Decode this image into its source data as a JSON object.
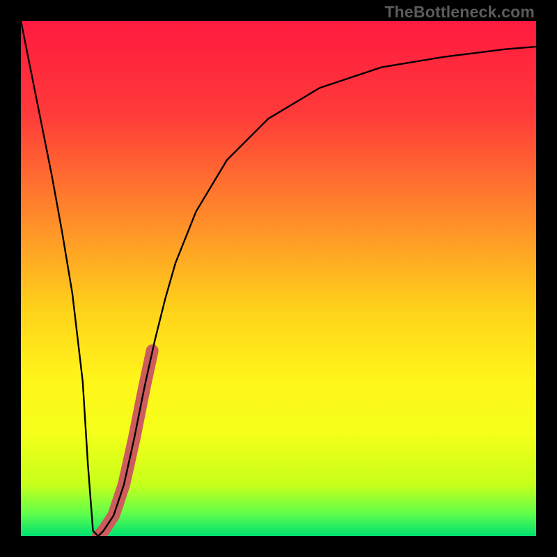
{
  "watermark": "TheBottleneck.com",
  "gradient": {
    "stops": [
      {
        "offset": 0.0,
        "color": "#ff1a3f"
      },
      {
        "offset": 0.18,
        "color": "#ff3a3a"
      },
      {
        "offset": 0.38,
        "color": "#ff8a2a"
      },
      {
        "offset": 0.56,
        "color": "#ffd21a"
      },
      {
        "offset": 0.7,
        "color": "#fff61a"
      },
      {
        "offset": 0.8,
        "color": "#f5ff1a"
      },
      {
        "offset": 0.9,
        "color": "#c7ff1a"
      },
      {
        "offset": 0.955,
        "color": "#63ff4a"
      },
      {
        "offset": 1.0,
        "color": "#00e070"
      }
    ]
  },
  "curve_color": "#000000",
  "accent_color": "#cd5c5c",
  "chart_data": {
    "type": "line",
    "title": "",
    "xlabel": "",
    "ylabel": "",
    "xlim": [
      0,
      100
    ],
    "ylim": [
      0,
      100
    ],
    "grid": false,
    "legend": false,
    "series": [
      {
        "name": "bottleneck-curve",
        "x": [
          0,
          2,
          4,
          6,
          8,
          10,
          12,
          13,
          14,
          15,
          16,
          18,
          20,
          22,
          24,
          26,
          28,
          30,
          34,
          40,
          48,
          58,
          70,
          82,
          94,
          100
        ],
        "y": [
          100,
          90,
          80,
          70,
          59,
          47,
          30,
          14,
          1,
          0,
          1,
          4,
          10,
          19,
          29,
          38,
          46,
          53,
          63,
          73,
          81,
          87,
          91,
          93,
          94.5,
          95
        ]
      }
    ],
    "accent_segment": {
      "name": "highlight-band",
      "x": [
        15,
        16,
        18,
        20,
        22,
        24,
        25.5
      ],
      "y": [
        0,
        1,
        4,
        10,
        19,
        29,
        36
      ]
    }
  }
}
